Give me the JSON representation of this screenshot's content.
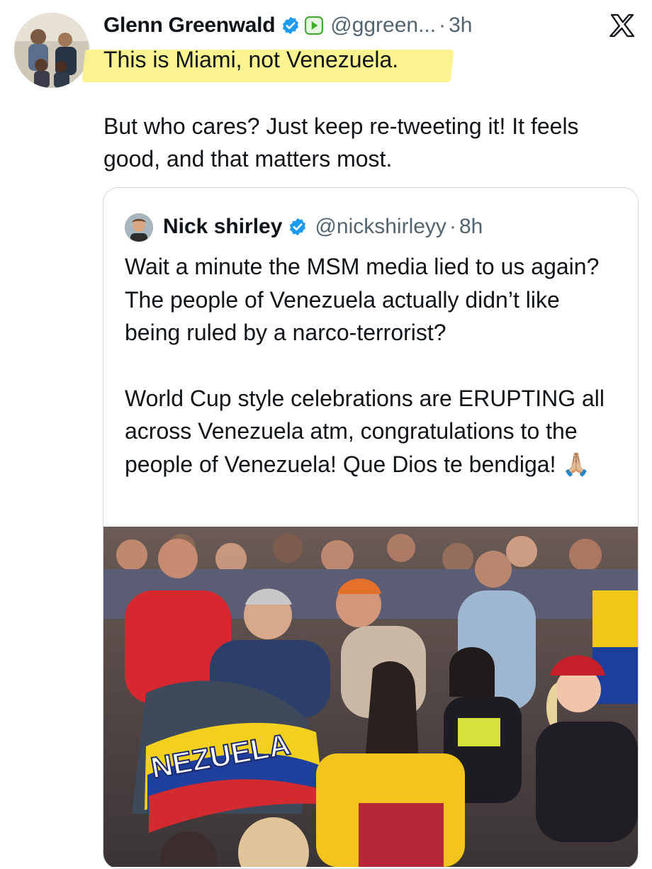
{
  "tweet": {
    "author_name": "Glenn Greenwald",
    "handle": "@ggreen...",
    "separator": "·",
    "time": "3h",
    "line1": "This is Miami, not Venezuela.",
    "body": "But who cares? Just keep re-tweeting it! It feels good, and that matters most."
  },
  "quoted": {
    "author_name": "Nick shirley",
    "handle": "@nickshirleyy",
    "separator": "·",
    "time": "8h",
    "para1": "Wait a minute the MSM media lied to us again? The people of Venezuela actually didn’t like being ruled by a narco-terrorist?",
    "para2": "World Cup style celebrations are ERUPTING all across Venezuela atm, congratulations to the people of Venezuela! Que Dios te bendiga! 🙏🏼",
    "photo_banner_text": "NEZUELA"
  },
  "colors": {
    "verified_blue": "#1d9bf0",
    "highlight_yellow": "#fbf38a",
    "secondary_text": "#536471",
    "border": "#cfd9de",
    "play_badge_green": "#3fae2a"
  },
  "icons": [
    "verified-badge-icon",
    "play-badge-icon",
    "x-logo-icon",
    "praying-hands-emoji"
  ]
}
